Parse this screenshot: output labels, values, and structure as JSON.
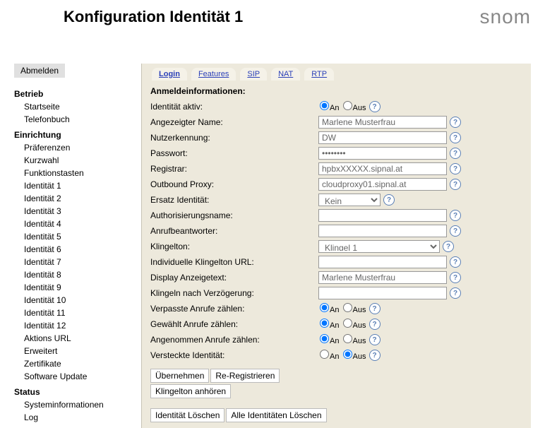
{
  "header": {
    "title": "Konfiguration Identität 1",
    "logo": "snom"
  },
  "sidebar": {
    "logout": "Abmelden",
    "sections": [
      {
        "title": "Betrieb",
        "items": [
          "Startseite",
          "Telefonbuch"
        ]
      },
      {
        "title": "Einrichtung",
        "items": [
          "Präferenzen",
          "Kurzwahl",
          "Funktionstasten",
          "Identität 1",
          "Identität 2",
          "Identität 3",
          "Identität 4",
          "Identität 5",
          "Identität 6",
          "Identität 7",
          "Identität 8",
          "Identität 9",
          "Identität 10",
          "Identität 11",
          "Identität 12",
          "Aktions URL",
          "Erweitert",
          "Zertifikate",
          "Software Update"
        ]
      },
      {
        "title": "Status",
        "items": [
          "Systeminformationen",
          "Log"
        ]
      }
    ]
  },
  "tabs": [
    {
      "label": "Login",
      "active": true
    },
    {
      "label": "Features",
      "active": false
    },
    {
      "label": "SIP",
      "active": false
    },
    {
      "label": "NAT",
      "active": false
    },
    {
      "label": "RTP",
      "active": false
    }
  ],
  "form": {
    "heading": "Anmeldeinformationen:",
    "radioOn": "An",
    "radioOff": "Aus",
    "rows": {
      "identitaet_aktiv": {
        "label": "Identität aktiv:",
        "type": "radio",
        "value": "An"
      },
      "angezeigter_name": {
        "label": "Angezeigter Name:",
        "type": "text",
        "value": "Marlene Musterfrau"
      },
      "nutzerkennung": {
        "label": "Nutzerkennung:",
        "type": "text",
        "value": "DW"
      },
      "passwort": {
        "label": "Passwort:",
        "type": "password",
        "value": "••••••••"
      },
      "registrar": {
        "label": "Registrar:",
        "type": "text",
        "value": "hpbxXXXXX.sipnal.at"
      },
      "outbound_proxy": {
        "label": "Outbound Proxy:",
        "type": "text",
        "value": "cloudproxy01.sipnal.at"
      },
      "ersatz_identitaet": {
        "label": "Ersatz Identität:",
        "type": "select",
        "value": "Kein"
      },
      "authorisierungsname": {
        "label": "Authorisierungsname:",
        "type": "text",
        "value": ""
      },
      "anrufbeantworter": {
        "label": "Anrufbeantworter:",
        "type": "text",
        "value": ""
      },
      "klingelton": {
        "label": "Klingelton:",
        "type": "select_wide",
        "value": "Klingel 1"
      },
      "individuelle_klingelton_url": {
        "label": "Individuelle Klingelton URL:",
        "type": "text",
        "value": ""
      },
      "display_anzeigetext": {
        "label": "Display Anzeigetext:",
        "type": "text",
        "value": "Marlene Musterfrau"
      },
      "klingeln_nach_verzoegerung": {
        "label": "Klingeln nach Verzögerung:",
        "type": "text",
        "value": ""
      },
      "verpasste_anrufe": {
        "label": "Verpasste Anrufe zählen:",
        "type": "radio",
        "value": "An"
      },
      "gewaehlt_anrufe": {
        "label": "Gewählt Anrufe zählen:",
        "type": "radio",
        "value": "An"
      },
      "angenommen_anrufe": {
        "label": "Angenommen Anrufe zählen:",
        "type": "radio",
        "value": "An"
      },
      "versteckte_identitaet": {
        "label": "Versteckte Identität:",
        "type": "radio",
        "value": "Aus"
      }
    },
    "buttons": {
      "uebernehmen": "Übernehmen",
      "re_registrieren": "Re-Registrieren",
      "klingelton_anhoeren": "Klingelton anhören",
      "identitaet_loeschen": "Identität Löschen",
      "alle_identitaeten_loeschen": "Alle Identitäten Löschen"
    }
  }
}
